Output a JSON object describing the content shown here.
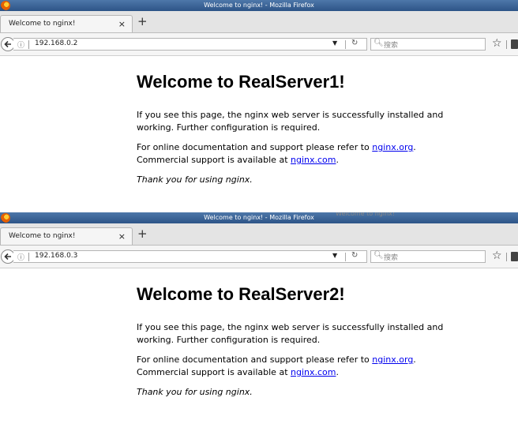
{
  "windows": [
    {
      "window_title": "Welcome to nginx! - Mozilla Firefox",
      "tab_label": "Welcome to nginx!",
      "tab_close": "×",
      "new_tab": "+",
      "back": "🡐",
      "url": "192.168.0.2",
      "search_placeholder": "搜索",
      "page": {
        "heading": "Welcome to RealServer1!",
        "para1": "If you see this page, the nginx web server is successfully installed and working. Further configuration is required.",
        "para2_before": "For online documentation and support please refer to ",
        "link1": "nginx.org",
        "para2_mid": ". Commercial support is available at ",
        "link2": "nginx.com",
        "para2_end": ".",
        "thanks": "Thank you for using nginx."
      }
    },
    {
      "window_title": "Welcome to nginx! - Mozilla Firefox",
      "tab_label": "Welcome to nginx!",
      "tab_close": "×",
      "new_tab": "+",
      "back": "🡐",
      "url": "192.168.0.3",
      "search_placeholder": "搜索",
      "page": {
        "heading": "Welcome to RealServer2!",
        "para1": "If you see this page, the nginx web server is successfully installed and working. Further configuration is required.",
        "para2_before": "For online documentation and support please refer to ",
        "link1": "nginx.org",
        "para2_mid": ". Commercial support is available at ",
        "link2": "nginx.com",
        "para2_end": ".",
        "thanks": "Thank you for using nginx."
      }
    }
  ],
  "overlap_ghost_text": "Welcome to nginx!",
  "colors": {
    "titlebar": "#3a659a",
    "link": "#0000ee"
  }
}
